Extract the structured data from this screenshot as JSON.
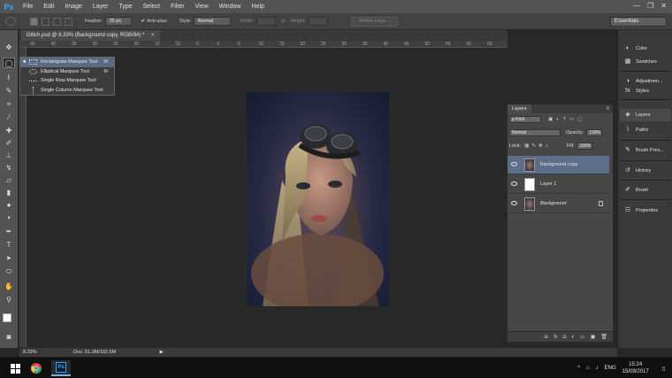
{
  "menubar": {
    "logo": "Ps",
    "items": [
      "File",
      "Edit",
      "Image",
      "Layer",
      "Type",
      "Select",
      "Filter",
      "View",
      "Window",
      "Help"
    ],
    "window_controls": [
      "—",
      "❐",
      "✕"
    ]
  },
  "options": {
    "feather_label": "Feather:",
    "feather_value": "25 px",
    "anti_alias_label": "Anti-alias",
    "anti_alias_check": "✔",
    "style_label": "Style:",
    "style_value": "Normal",
    "width_label": "Width:",
    "height_label": "Height:",
    "refine_edge": "Refine Edge...",
    "workspace": "Essentials",
    "swap_icon": "⇄"
  },
  "document": {
    "tab_title": "Glitch.psd @ 8.33% (Background copy, RGB/8#) *",
    "tab_close": "×",
    "ruler_ticks": [
      "45",
      "40",
      "35",
      "30",
      "25",
      "20",
      "15",
      "10",
      "5",
      "0",
      "5",
      "10",
      "15",
      "20",
      "25",
      "30",
      "35",
      "40",
      "45",
      "50",
      "55",
      "60",
      "65"
    ]
  },
  "flyout": {
    "items": [
      {
        "label": "Rectangular Marquee Tool",
        "shortcut": "M",
        "bullet": "■"
      },
      {
        "label": "Elliptical Marquee Tool",
        "shortcut": "M",
        "bullet": ""
      },
      {
        "label": "Single Row Marquee Tool",
        "shortcut": "",
        "bullet": ""
      },
      {
        "label": "Single Column Marquee Tool",
        "shortcut": "",
        "bullet": ""
      }
    ]
  },
  "panels_collapsed": [
    {
      "label": "Color",
      "icon": "palette-icon",
      "glyph": "◐"
    },
    {
      "label": "Swatches",
      "icon": "swatches-icon",
      "glyph": "▦"
    },
    {
      "label": "Adjustmen...",
      "icon": "adjustments-icon",
      "glyph": "◑"
    },
    {
      "label": "Styles",
      "icon": "styles-icon",
      "glyph": "fx"
    },
    {
      "label": "Layers",
      "icon": "layers-icon",
      "glyph": "◈"
    },
    {
      "label": "Paths",
      "icon": "paths-icon",
      "glyph": "⌇"
    },
    {
      "label": "Brush Pres...",
      "icon": "brush-presets-icon",
      "glyph": "✎"
    },
    {
      "label": "History",
      "icon": "history-icon",
      "glyph": "↺"
    },
    {
      "label": "Brush",
      "icon": "brush-icon",
      "glyph": "✐"
    },
    {
      "label": "Properties",
      "icon": "properties-icon",
      "glyph": "☷"
    }
  ],
  "layers": {
    "tab_label": "Layers",
    "menu_glyph": "≡",
    "filter_kind": "ρ Kind",
    "blend_mode": "Normal",
    "opacity_label": "Opacity:",
    "opacity_value": "100%",
    "lock_label": "Lock:",
    "fill_label": "Fill:",
    "fill_value": "100%",
    "items": [
      {
        "name": "Background copy",
        "selected": true,
        "thumb": "photo",
        "locked": false
      },
      {
        "name": "Layer 1",
        "selected": false,
        "thumb": "white",
        "locked": false
      },
      {
        "name": "Background",
        "selected": false,
        "thumb": "photo",
        "locked": true
      }
    ],
    "footer_icons": [
      "⊖",
      "fx",
      "◘",
      "◐",
      "▭",
      "▣",
      "🗑"
    ]
  },
  "status": {
    "zoom": "8.33%",
    "doc": "Doc: 51.3M/102.5M",
    "arrow": "▶"
  },
  "taskbar": {
    "language": "ENG",
    "time": "15:24",
    "date": "15/09/2017",
    "tray_glyphs": [
      "^",
      "⌂",
      "♪",
      "▯"
    ]
  },
  "colors": {
    "ps_blue": "#31a8ff",
    "selection": "#5d6f88"
  }
}
